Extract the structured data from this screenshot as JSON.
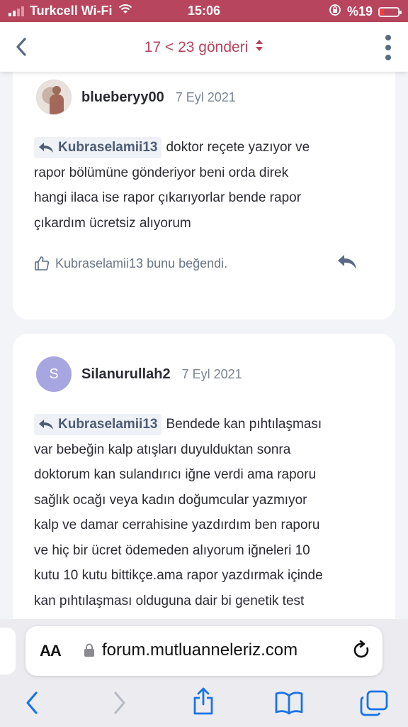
{
  "status_bar": {
    "carrier": "Turkcell Wi-Fi",
    "time": "15:06",
    "battery": "%19"
  },
  "header": {
    "title": "17 < 23 gönderi"
  },
  "posts": [
    {
      "username": "blueberyy00",
      "date": "7 Eyl 2021",
      "quote_user": "Kubraselamii13",
      "lines": [
        "doktor reçete yazıyor ve",
        "rapor bölümüne gönderiyor beni orda direk",
        "hangi ilaca ise rapor çıkarıyorlar bende rapor",
        "çıkardım ücretsiz alıyorum"
      ],
      "likes": "Kubraselamii13 bunu beğendi."
    },
    {
      "username": "Silanurullah2",
      "date": "7 Eyl 2021",
      "avatar_letter": "S",
      "quote_user": "Kubraselamii13",
      "lines": [
        "Bendede kan pıhtılaşması",
        "var bebeğin kalp atışları duyulduktan sonra",
        "doktorum kan sulandırıcı iğne verdi ama raporu",
        "sağlık ocağı veya kadın doğumcular yazmıyor",
        "kalp ve damar cerrahisine yazdırdım ben raporu",
        "ve hiç bir ücret ödemeden alıyorum iğneleri 10",
        "kutu 10 kutu bittikçe.ama rapor yazdırmak içinde",
        "kan pıhtılaşması olduguna dair bi genetik test"
      ]
    }
  ],
  "browser": {
    "aa_label": "AA",
    "url": "forum.mutluanneleriz.com"
  },
  "colors": {
    "accent": "#b7455d",
    "avatar_s": "#a8a6e0",
    "ios_blue": "#1a73e8"
  }
}
